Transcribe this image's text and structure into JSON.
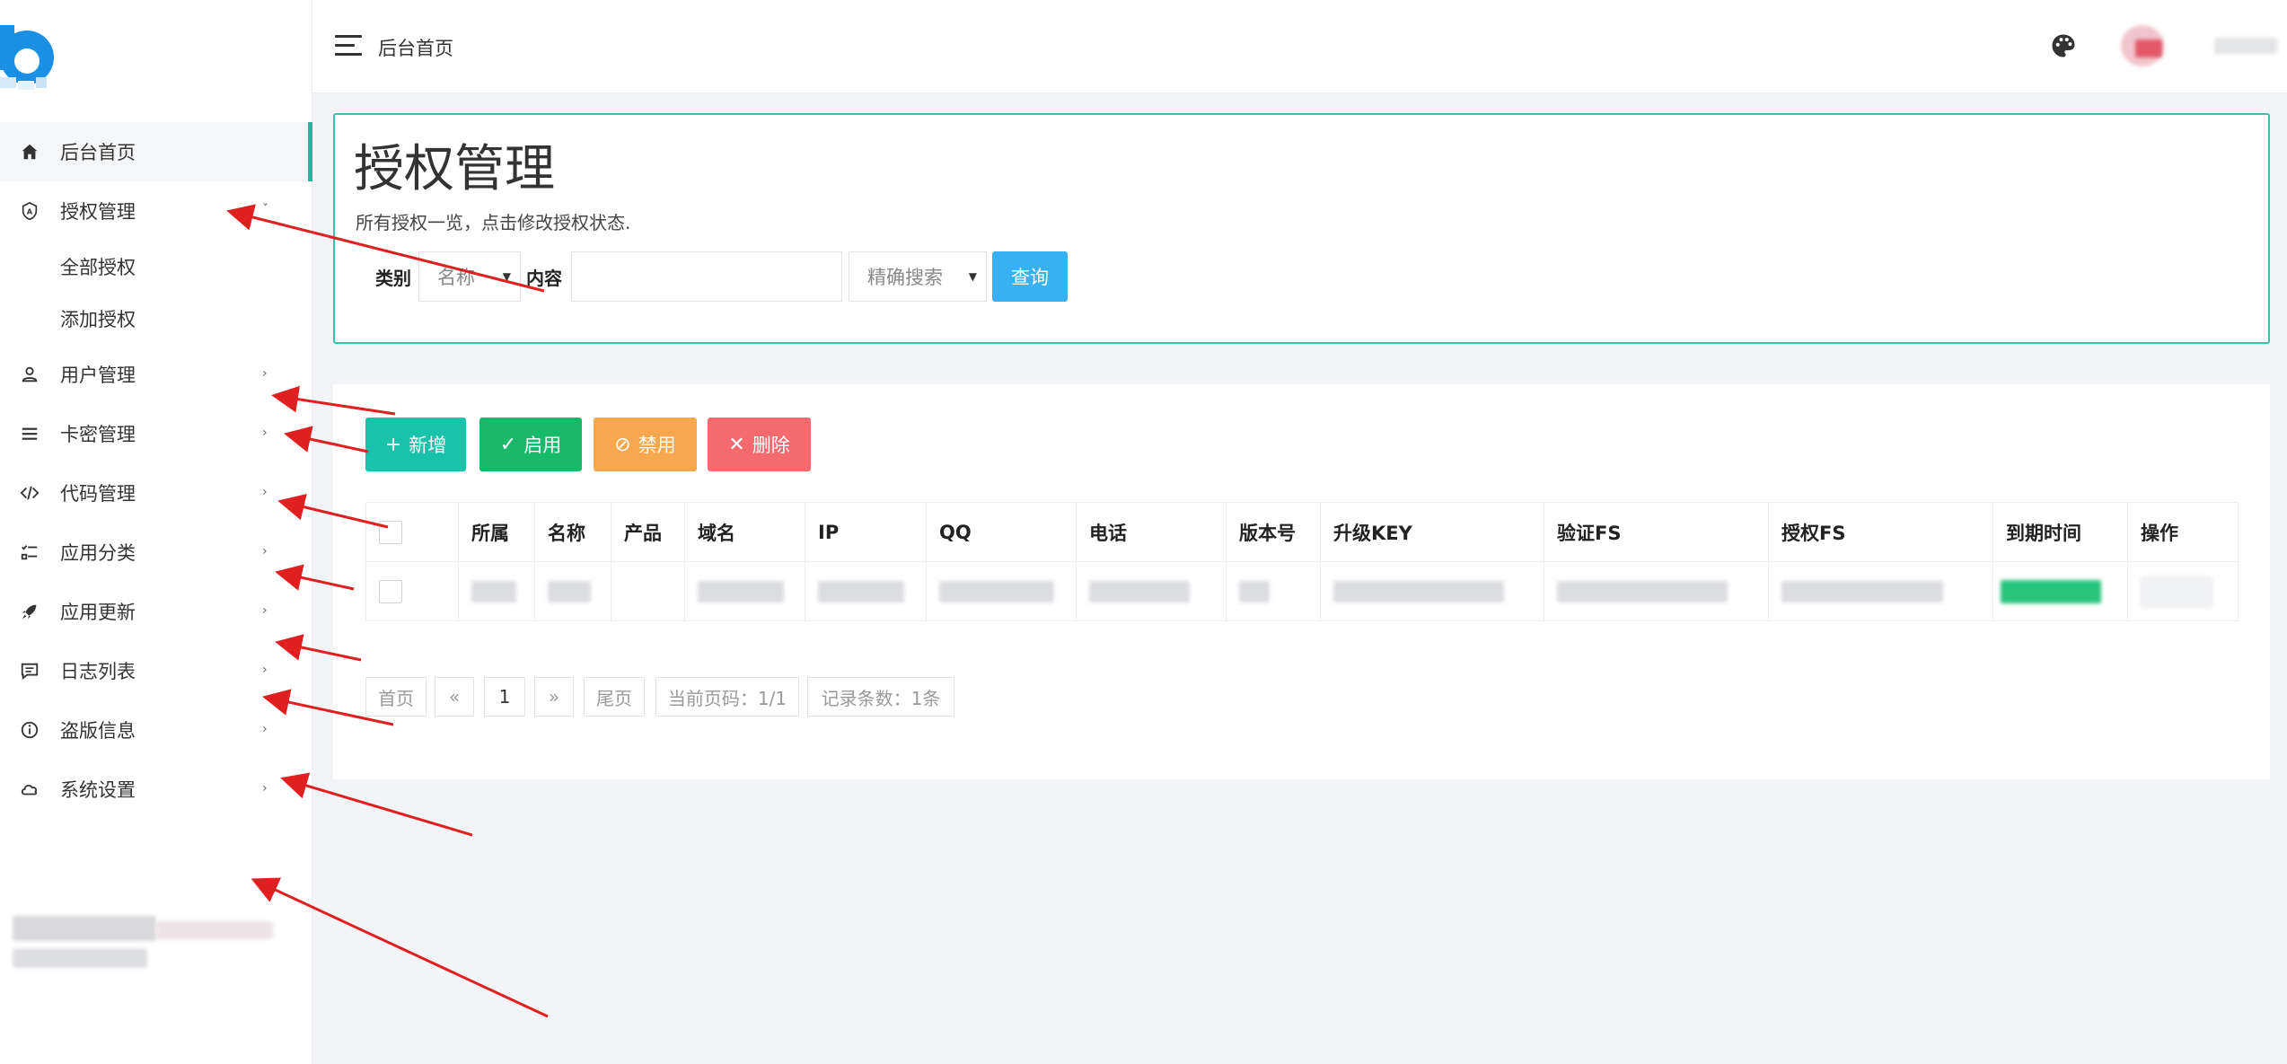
{
  "sidebar": {
    "nav": [
      {
        "label": "后台首页",
        "icon": "home-icon",
        "active": true
      },
      {
        "label": "授权管理",
        "icon": "shield-icon",
        "expanded": true,
        "children": [
          {
            "label": "全部授权"
          },
          {
            "label": "添加授权"
          }
        ]
      },
      {
        "label": "用户管理",
        "icon": "user-icon"
      },
      {
        "label": "卡密管理",
        "icon": "list-icon"
      },
      {
        "label": "代码管理",
        "icon": "code-icon"
      },
      {
        "label": "应用分类",
        "icon": "category-list-icon"
      },
      {
        "label": "应用更新",
        "icon": "rocket-icon"
      },
      {
        "label": "日志列表",
        "icon": "message-icon"
      },
      {
        "label": "盗版信息",
        "icon": "info-icon"
      },
      {
        "label": "系统设置",
        "icon": "cloud-icon"
      }
    ],
    "caret_down": "ˇ",
    "caret_right": "›"
  },
  "header": {
    "breadcrumb": "后台首页"
  },
  "hero": {
    "title": "授权管理",
    "description": "所有授权一览，点击修改授权状态.",
    "category_label": "类别",
    "category_value": "名称",
    "content_label": "内容",
    "content_value": "",
    "mode_value": "精确搜索",
    "query_label": "查询"
  },
  "toolbar": {
    "add": "新增",
    "enable": "启用",
    "disable": "禁用",
    "delete": "删除"
  },
  "table": {
    "columns": [
      "所属",
      "名称",
      "产品",
      "域名",
      "IP",
      "QQ",
      "电话",
      "版本号",
      "升级KEY",
      "验证FS",
      "授权FS",
      "到期时间",
      "操作"
    ]
  },
  "pagination": {
    "first": "首页",
    "prev": "«",
    "page": "1",
    "next": "»",
    "last": "尾页",
    "current_info": "当前页码：1/1",
    "record_info": "记录条数：1条"
  },
  "colors": {
    "accent": "#20b69e",
    "add": "#19c2a8",
    "enable": "#19b96b",
    "disable": "#f7a84e",
    "delete": "#f46a6f",
    "query": "#3ab0f4",
    "annotation": "#e02020"
  }
}
